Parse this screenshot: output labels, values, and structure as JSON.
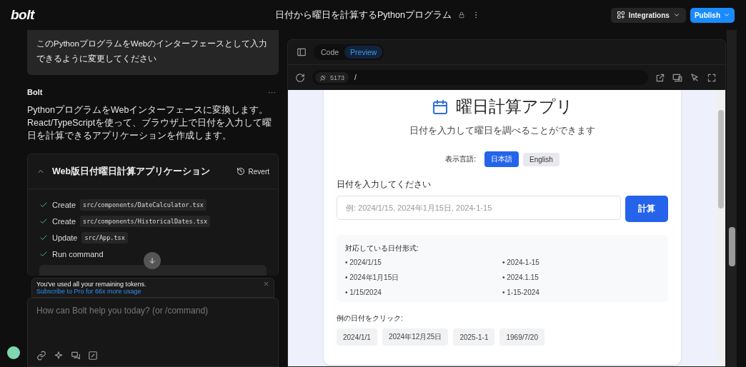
{
  "topbar": {
    "logo": "bolt",
    "project_title": "日付から曜日を計算するPythonプログラム",
    "integrations": "Integrations",
    "publish": "Publish"
  },
  "chat": {
    "user_message": "このPythonプログラムをWebのインターフェースとして入力できるように変更してください",
    "assistant": {
      "name": "Bolt",
      "more": "···",
      "lines": [
        "PythonプログラムをWebインターフェースに変換します。",
        "React/TypeScriptを使って、ブラウザ上で日付を入力して曜日を計算できるアプリケーションを作成します。"
      ]
    },
    "artifact": {
      "title": "Web版日付曜日計算アプリケーション",
      "expanded": true,
      "revert": "Revert",
      "actions": [
        {
          "verb": "Create",
          "path": "src/components/DateCalculator.tsx",
          "done": true
        },
        {
          "verb": "Create",
          "path": "src/components/HistoricalDates.tsx",
          "done": true
        },
        {
          "verb": "Update",
          "path": "src/App.tsx",
          "done": true
        },
        {
          "verb": "Run command",
          "done": true
        }
      ]
    },
    "notice": {
      "text": "You've used all your remaining tokens.",
      "link": "Subscribe to Pro for 66x more usage"
    },
    "input": {
      "placeholder": "How can Bolt help you today? (or /command)"
    }
  },
  "preview": {
    "tabs": [
      {
        "label": "Code",
        "selected": false
      },
      {
        "label": "Preview",
        "selected": true
      }
    ],
    "port": "5173",
    "path": "/",
    "app": {
      "title": "曜日計算アプリ",
      "subtitle": "日付を入力して曜日を調べることができます",
      "language_label": "表示言語:",
      "languages": [
        {
          "label": "日本語",
          "selected": true
        },
        {
          "label": "English",
          "selected": false
        }
      ],
      "input_label": "日付を入力してください",
      "input_placeholder": "例: 2024/1/15, 2024年1月15日, 2024-1-15",
      "calculate": "計算",
      "formats_title": "対応している日付形式:",
      "formats": [
        "• 2024/1/15",
        "• 2024-1-15",
        "• 2024年1月15日",
        "• 2024.1.15",
        "• 1/15/2024",
        "• 1-15-2024"
      ],
      "examples_label": "例の日付をクリック:",
      "examples": [
        "2024/1/1",
        "2024年12月25日",
        "2025-1-1",
        "1969/7/20"
      ]
    }
  }
}
